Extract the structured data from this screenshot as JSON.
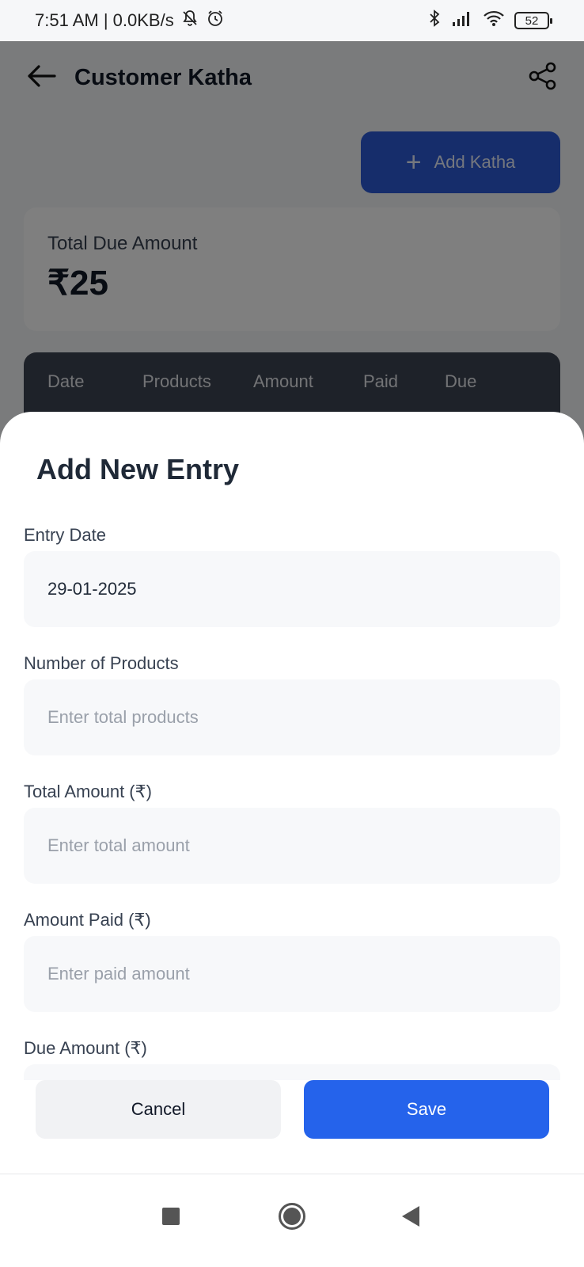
{
  "status_bar": {
    "time_info": "7:51 AM | 0.0KB/s",
    "battery": "52",
    "icons": [
      "mute-icon",
      "alarm-icon",
      "bluetooth-icon",
      "signal-icon",
      "wifi-icon",
      "battery-icon"
    ]
  },
  "header": {
    "title": "Customer Katha",
    "back_icon": "arrow-left-icon",
    "share_icon": "share-icon"
  },
  "add_katha": {
    "label": "Add Katha",
    "icon": "plus-icon"
  },
  "summary": {
    "label": "Total Due Amount",
    "value": "₹25"
  },
  "table": {
    "columns": [
      "Date",
      "Products",
      "Amount",
      "Paid",
      "Due"
    ]
  },
  "sheet": {
    "title": "Add New Entry",
    "fields": [
      {
        "label": "Entry Date",
        "value": "29-01-2025",
        "placeholder": ""
      },
      {
        "label": "Number of Products",
        "value": "",
        "placeholder": "Enter total products"
      },
      {
        "label": "Total Amount (₹)",
        "value": "",
        "placeholder": "Enter total amount"
      },
      {
        "label": "Amount Paid (₹)",
        "value": "",
        "placeholder": "Enter paid amount"
      },
      {
        "label": "Due Amount (₹)",
        "value": "",
        "placeholder": ""
      }
    ],
    "cancel_label": "Cancel",
    "save_label": "Save"
  },
  "colors": {
    "primary": "#2563eb",
    "table_header": "#3d4452"
  }
}
